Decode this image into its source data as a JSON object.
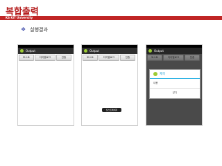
{
  "slide": {
    "title": "복합출력",
    "brand": "KS KIT University",
    "bullet": "실행결과"
  },
  "app": {
    "title": "Output",
    "buttons": {
      "toast": "토스트",
      "dialog": "다이얼로그",
      "finish": "전종"
    }
  },
  "toast": {
    "text": "토스트메세지"
  },
  "dialog": {
    "title": "제목",
    "message": "내용",
    "ok": "닫기"
  },
  "colors": {
    "accent_red": "#c02525",
    "android_green": "#9ccb34",
    "holo_blue": "#33b5e5"
  },
  "icons": {
    "bullet": "diamond-bullet-icon",
    "app": "android-icon"
  }
}
